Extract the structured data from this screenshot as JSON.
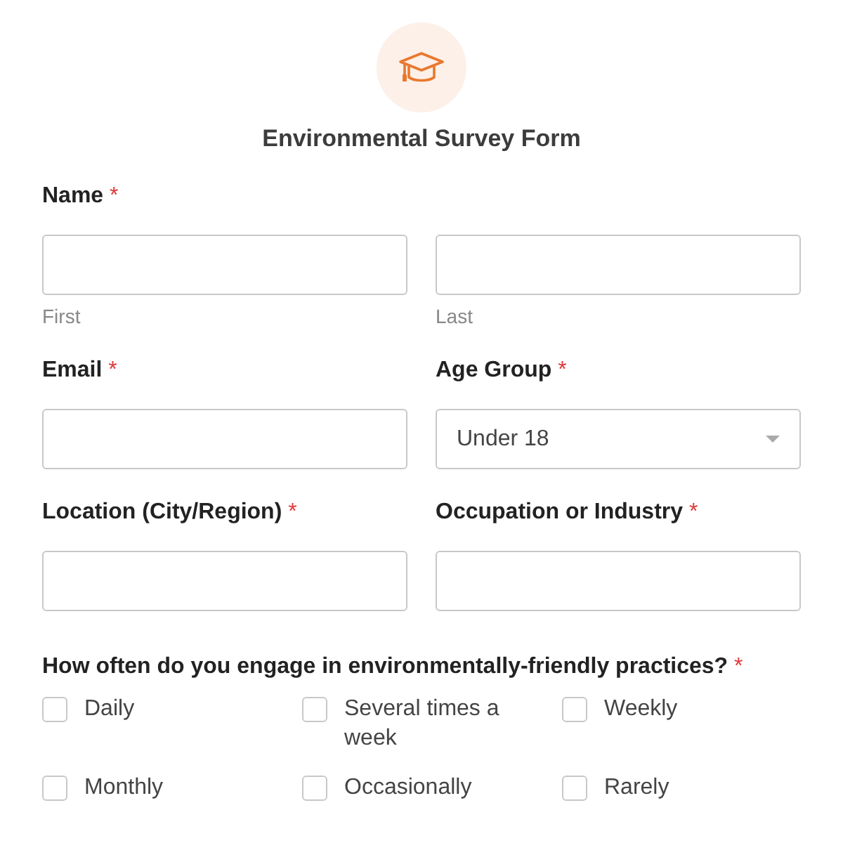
{
  "form": {
    "title": "Environmental Survey Form"
  },
  "rows": [
    {
      "fields": [
        {
          "kind": "name",
          "label": "Name",
          "required_mark": "*",
          "subfields": [
            {
              "sublabel": "First"
            },
            {
              "sublabel": "Last"
            }
          ]
        }
      ]
    },
    {
      "fields": [
        {
          "kind": "text",
          "label": "Email",
          "required_mark": "*"
        },
        {
          "kind": "select",
          "label": "Age Group",
          "required_mark": "*",
          "value": "Under 18"
        }
      ]
    },
    {
      "fields": [
        {
          "kind": "text",
          "label": "Location (City/Region)",
          "required_mark": "*"
        },
        {
          "kind": "text",
          "label": "Occupation or Industry",
          "required_mark": "*"
        }
      ]
    }
  ],
  "question": {
    "label": "How often do you engage in environmentally-friendly practices?",
    "required_mark": "*",
    "options": [
      {
        "label": "Daily",
        "checked": false
      },
      {
        "label": "Several times a week",
        "checked": false
      },
      {
        "label": "Weekly",
        "checked": false
      },
      {
        "label": "Monthly",
        "checked": false
      },
      {
        "label": "Occasionally",
        "checked": false
      },
      {
        "label": "Rarely",
        "checked": false
      }
    ]
  }
}
